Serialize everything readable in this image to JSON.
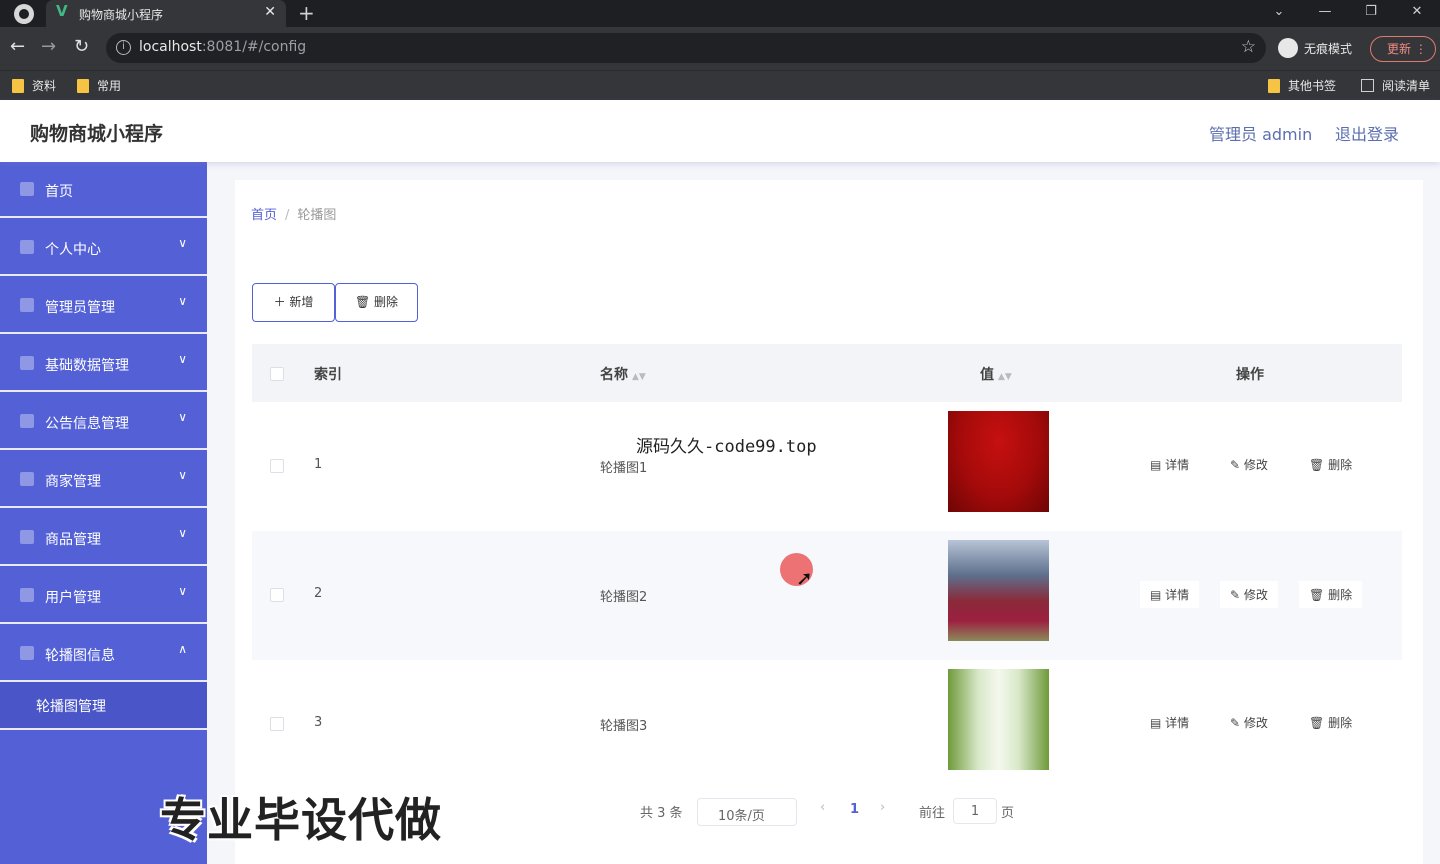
{
  "browser": {
    "tab_title": "购物商城小程序",
    "url_host": "localhost",
    "url_rest": ":8081/#/config",
    "profile_label": "无痕模式",
    "update_label": "更新",
    "bookmarks": [
      "资料",
      "常用"
    ],
    "bookmarks_right": [
      "其他书签",
      "阅读清单"
    ]
  },
  "header": {
    "title": "购物商城小程序",
    "admin_label": "管理员 admin",
    "logout_label": "退出登录"
  },
  "sidebar": {
    "items": [
      {
        "label": "首页",
        "icon": "home-icon"
      },
      {
        "label": "个人中心",
        "icon": "user-icon"
      },
      {
        "label": "管理员管理",
        "icon": "admin-icon"
      },
      {
        "label": "基础数据管理",
        "icon": "grid-icon"
      },
      {
        "label": "公告信息管理",
        "icon": "notice-icon"
      },
      {
        "label": "商家管理",
        "icon": "shop-icon"
      },
      {
        "label": "商品管理",
        "icon": "chart-icon"
      },
      {
        "label": "用户管理",
        "icon": "users-icon"
      },
      {
        "label": "轮播图信息",
        "icon": "send-icon"
      }
    ],
    "sub_item": "轮播图管理"
  },
  "breadcrumb": {
    "home": "首页",
    "current": "轮播图"
  },
  "toolbar": {
    "add_label": "新增",
    "delete_label": "删除"
  },
  "table": {
    "headers": {
      "index": "索引",
      "name": "名称",
      "value": "值",
      "actions": "操作"
    },
    "rows": [
      {
        "index": "1",
        "name": "轮播图1",
        "image": "red-fabric"
      },
      {
        "index": "2",
        "name": "轮播图2",
        "image": "mountain-trees"
      },
      {
        "index": "3",
        "name": "轮播图3",
        "image": "green-forest"
      }
    ],
    "actions": {
      "detail": "详情",
      "edit": "修改",
      "delete": "删除"
    }
  },
  "pager": {
    "total": "共 3 条",
    "page_size": "10条/页",
    "current": "1",
    "goto_label": "前往",
    "goto_value": "1",
    "page_suffix": "页"
  },
  "overlay": {
    "watermark": "源码久久-code99.top",
    "bottom_text": "专业毕设代做"
  },
  "colors": {
    "accent": "#5461d6"
  }
}
